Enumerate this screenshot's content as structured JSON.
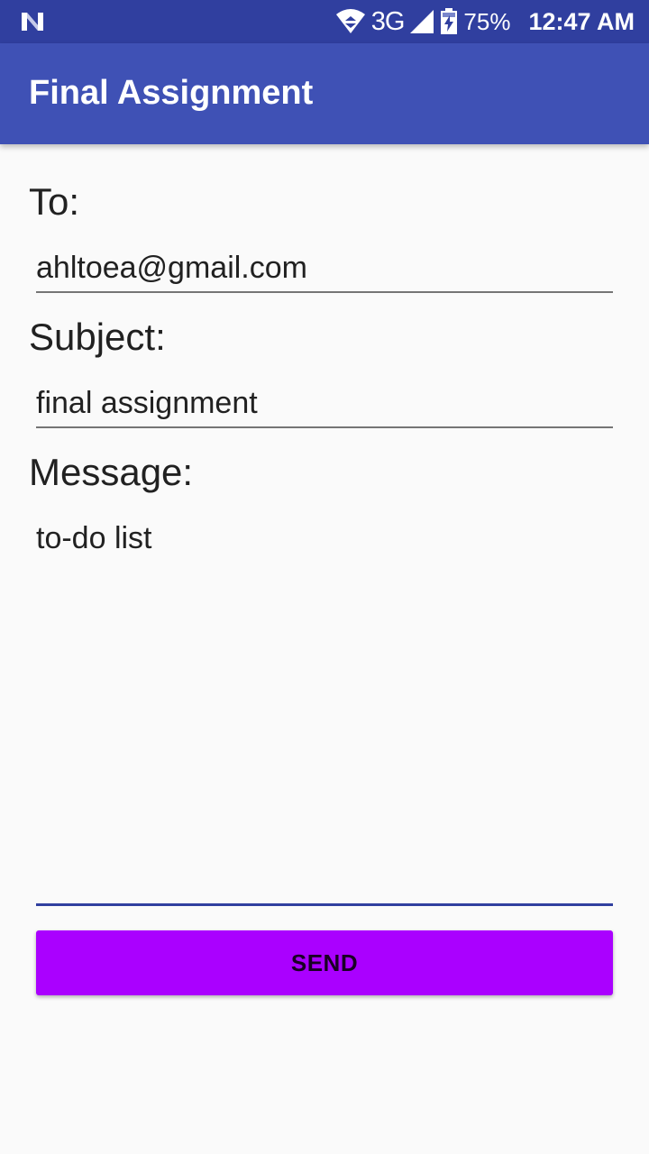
{
  "status_bar": {
    "network": "3G",
    "battery": "75%",
    "time": "12:47 AM",
    "icons": [
      "notification-n-icon",
      "wifi-icon",
      "signal-icon",
      "battery-charging-icon"
    ]
  },
  "app_bar": {
    "title": "Final Assignment",
    "color": "#3f51b5"
  },
  "form": {
    "to_label": "To:",
    "to_value": "ahltoea@gmail.com",
    "subject_label": "Subject:",
    "subject_value": "final assignment",
    "message_label": "Message:",
    "message_value": "to-do list",
    "message_focused": true
  },
  "send_button": {
    "label": "SEND",
    "color": "#aa00ff"
  }
}
